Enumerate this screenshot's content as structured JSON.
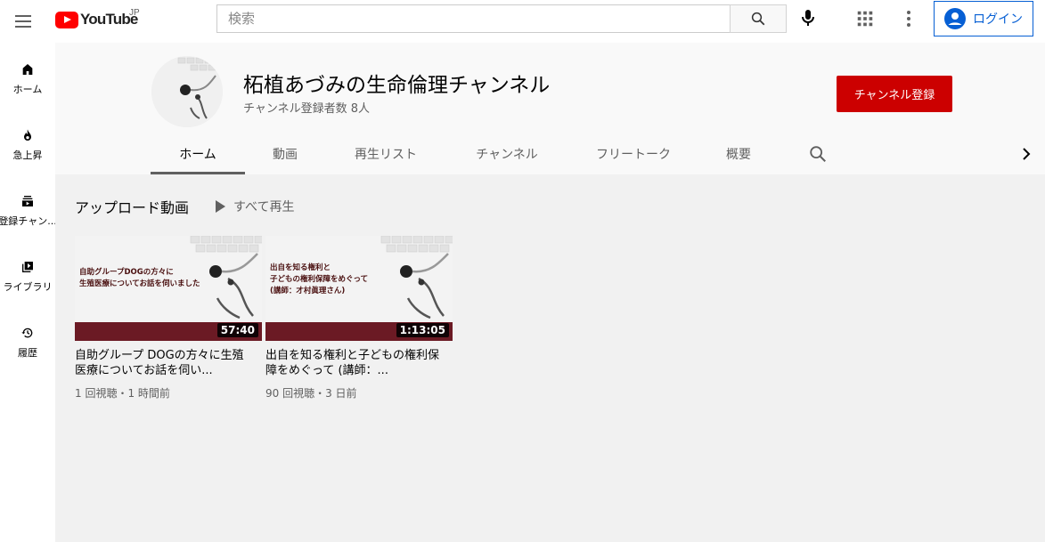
{
  "header": {
    "logo_text": "YouTube",
    "logo_region": "JP",
    "search_placeholder": "検索",
    "login_label": "ログイン"
  },
  "sidebar": {
    "items": [
      {
        "label": "ホーム",
        "icon": "home-icon"
      },
      {
        "label": "急上昇",
        "icon": "trending-icon"
      },
      {
        "label": "登録チャン...",
        "icon": "subscriptions-icon"
      },
      {
        "label": "ライブラリ",
        "icon": "library-icon"
      },
      {
        "label": "履歴",
        "icon": "history-icon"
      }
    ]
  },
  "channel": {
    "title": "柘植あづみの生命倫理チャンネル",
    "subscriber_count": "チャンネル登録者数 8人",
    "subscribe_label": "チャンネル登録"
  },
  "tabs": [
    {
      "label": "ホーム",
      "active": true
    },
    {
      "label": "動画",
      "active": false
    },
    {
      "label": "再生リスト",
      "active": false
    },
    {
      "label": "チャンネル",
      "active": false
    },
    {
      "label": "フリートーク",
      "active": false
    },
    {
      "label": "概要",
      "active": false
    }
  ],
  "section": {
    "title": "アップロード動画",
    "play_all": "すべて再生"
  },
  "videos": [
    {
      "thumb_lines": [
        "自助グループDOGの方々に",
        "生殖医療についてお話を伺いました"
      ],
      "duration": "57:40",
      "title": "自助グループ DOGの方々に生殖医療についてお話を伺い...",
      "meta": "1 回視聴・1 時間前"
    },
    {
      "thumb_lines": [
        "出自を知る権利と",
        "子どもの権利保障をめぐって",
        "(講師：才村眞理さん)"
      ],
      "duration": "1:13:05",
      "title": "出自を知る権利と子どもの権利保障をめぐって (講師：...",
      "meta": "90 回視聴・3 日前"
    }
  ],
  "colors": {
    "brand_red": "#ff0000",
    "subscribe_red": "#cc0000",
    "link_blue": "#065fd4",
    "thumb_band": "#6b1a24"
  }
}
